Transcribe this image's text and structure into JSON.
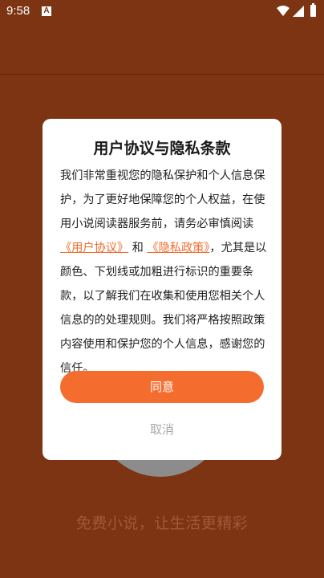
{
  "status_bar": {
    "time": "9:58",
    "notification_letter": "A",
    "icons": [
      "wifi-icon",
      "signal-icon",
      "battery-icon"
    ]
  },
  "background": {
    "slogan": "免费小说，让生活更精彩"
  },
  "dialog": {
    "title": "用户协议与隐私条款",
    "text_1": "我们非常重视您的隐私保护和个人信息保护，为了更好地保障您的个人权益，在使用小说阅读器服务前，请务必审慎阅读",
    "link_user_agreement": "《用户协议》",
    "text_and": " 和 ",
    "link_privacy_policy": "《隐私政策》",
    "text_2": "，尤其是以颜色、下划线或加粗进行标识的重要条款，以了解我们在收集和使用您相关个人信息的的处理规则。我们将严格按照政策内容使用和保护您的个人信息，感谢您的信任。",
    "agree_label": "同意",
    "cancel_label": "取消"
  },
  "colors": {
    "background": "#7c3412",
    "accent": "#f56d2e",
    "link": "#f06b2c"
  }
}
